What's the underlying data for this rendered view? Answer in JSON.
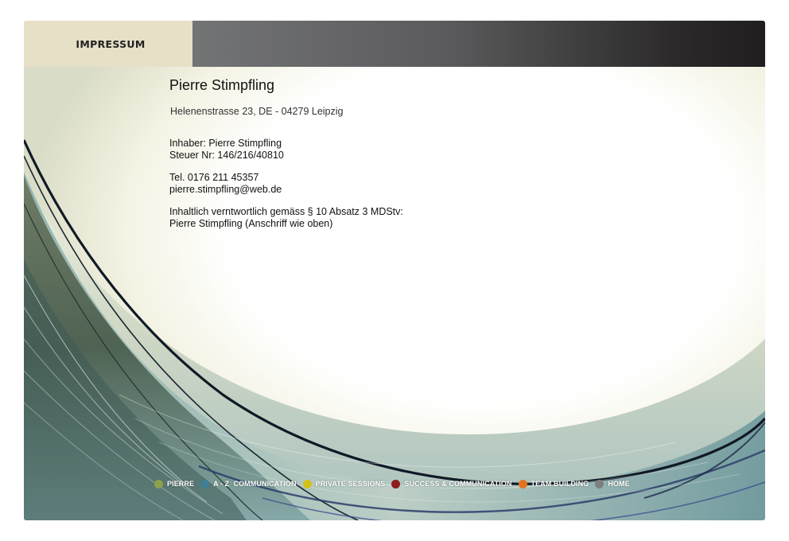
{
  "header": {
    "title": "IMPRESSUM"
  },
  "content": {
    "name": "Pierre Stimpfling",
    "address": "Helenenstrasse 23, DE - 04279 Leipzig",
    "owner": "Inhaber: Pierre Stimpfling",
    "tax_number": "Steuer Nr: 146/216/40810",
    "phone": "Tel. 0176 211 45357",
    "email": "pierre.stimpfling@web.de",
    "responsible_label": "Inhaltlich verntwortlich gemäss § 10 Absatz 3 MDStv:",
    "responsible_name": "Pierre Stimpfling (Anschriff wie oben)"
  },
  "nav": {
    "items": [
      {
        "label": "PIERRE",
        "color": "#8fa04a"
      },
      {
        "label": "A - Z  COMMUNICATION",
        "color": "#3e7f95"
      },
      {
        "label": "PRIVATE SESSIONS",
        "color": "#d3c11a"
      },
      {
        "label": "SUCCESS & COMMUNICATION",
        "color": "#8e1b1d"
      },
      {
        "label": "TEAM BUILDING",
        "color": "#e2731e"
      },
      {
        "label": "HOME",
        "color": "#7d7f80"
      }
    ]
  }
}
